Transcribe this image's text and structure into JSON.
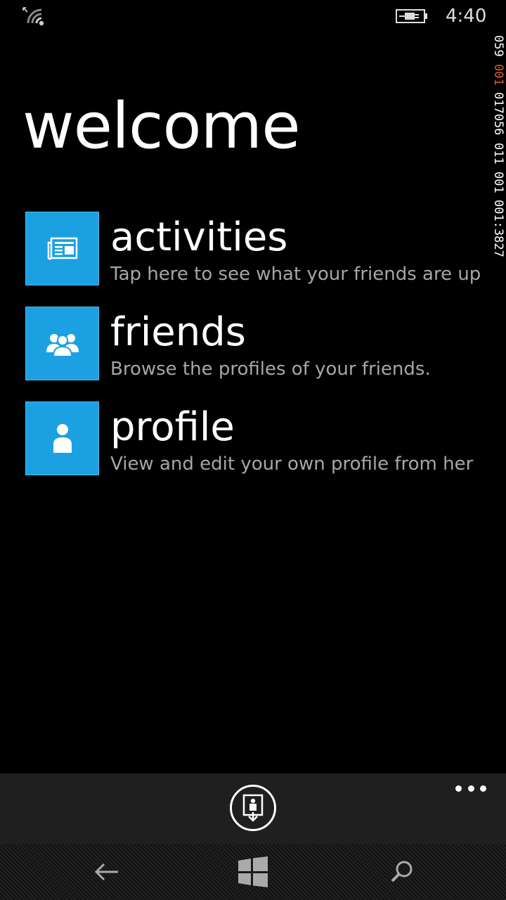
{
  "status": {
    "time": "4:40",
    "signal_icon": "wifi-signal-icon",
    "battery_icon": "battery-charging-icon"
  },
  "page": {
    "title": "welcome"
  },
  "menu": [
    {
      "title": "activities",
      "description": "Tap here to see what your friends are up",
      "icon": "newspaper-icon"
    },
    {
      "title": "friends",
      "description": "Browse the profiles of your friends.",
      "icon": "people-icon"
    },
    {
      "title": "profile",
      "description": "View and edit your own profile from her",
      "icon": "person-icon"
    }
  ],
  "debug_counter": [
    "059",
    "001",
    "017056",
    "011",
    "001",
    "001:3827"
  ],
  "app_bar": {
    "button_icon": "elevator-down-icon",
    "more_icon": "more-dots-icon"
  },
  "nav_bar": {
    "back_icon": "back-arrow-icon",
    "start_icon": "windows-logo-icon",
    "search_icon": "search-icon"
  },
  "colors": {
    "accent": "#1ba1e2",
    "background": "#000000",
    "secondary_text": "#a6a6a6",
    "counter_red": "#e05a2b"
  }
}
